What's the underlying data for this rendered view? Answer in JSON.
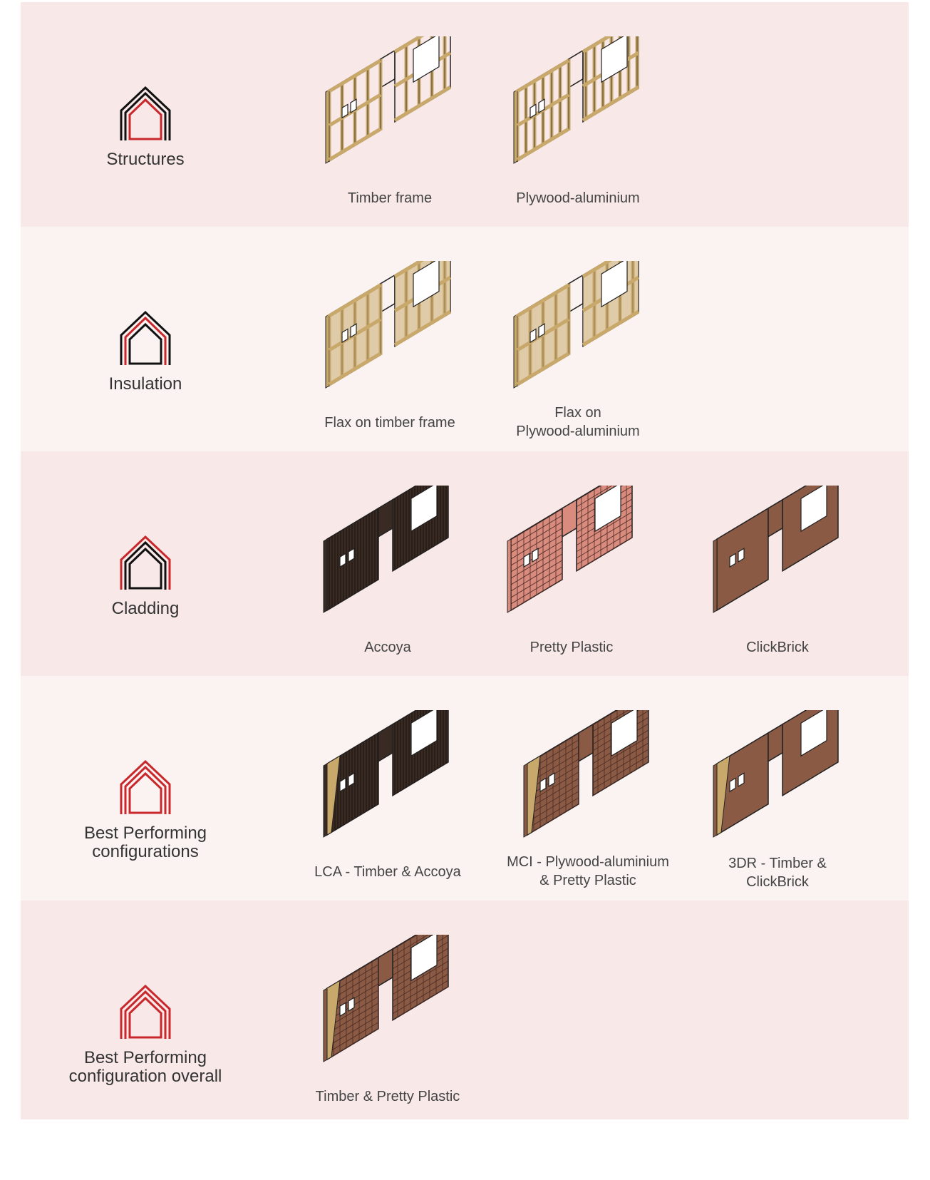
{
  "colors": {
    "row_dark": "#f8e8e7",
    "row_light": "#fbf3f2",
    "accent_red": "#c8282c",
    "timber": "#c9a96b",
    "accoya": "#3a2a24",
    "pretty_plastic": "#d98b7e",
    "clickbrick": "#8a5a44"
  },
  "rows": [
    {
      "category": "Structures",
      "icon": "house-outline-icon",
      "items": [
        {
          "caption": [
            "Timber frame"
          ],
          "style": "timber-frame"
        },
        {
          "caption": [
            "Plywood-aluminium"
          ],
          "style": "plywood-frame"
        }
      ]
    },
    {
      "category": "Insulation",
      "icon": "house-outline-icon",
      "items": [
        {
          "caption": [
            "Flax on timber frame"
          ],
          "style": "flax-timber"
        },
        {
          "caption": [
            "Flax on",
            "Plywood-aluminium"
          ],
          "style": "flax-plywood"
        }
      ]
    },
    {
      "category": "Cladding",
      "icon": "house-outline-icon",
      "items": [
        {
          "caption": [
            "Accoya"
          ],
          "style": "accoya"
        },
        {
          "caption": [
            "Pretty Plastic"
          ],
          "style": "pretty-plastic"
        },
        {
          "caption": [
            "ClickBrick"
          ],
          "style": "clickbrick"
        }
      ]
    },
    {
      "category": [
        "Best Performing",
        "configurations"
      ],
      "icon": "house-outline-icon",
      "items": [
        {
          "caption": [
            "LCA - Timber & Accoya"
          ],
          "style": "combo-accoya"
        },
        {
          "caption": [
            "MCI - Plywood-aluminium",
            "& Pretty Plastic"
          ],
          "style": "combo-plastic"
        },
        {
          "caption": [
            "3DR - Timber &",
            "ClickBrick"
          ],
          "style": "combo-clickbrick"
        }
      ]
    },
    {
      "category": [
        "Best Performing",
        "configuration overall"
      ],
      "icon": "house-outline-icon",
      "items": [
        {
          "caption": [
            "Timber & Pretty Plastic"
          ],
          "style": "combo-overall"
        }
      ]
    }
  ]
}
